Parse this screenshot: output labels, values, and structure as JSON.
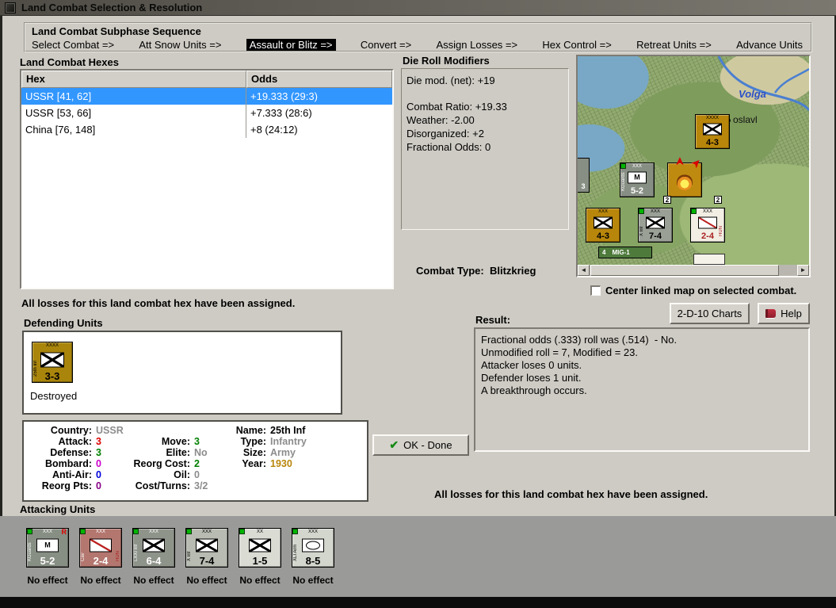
{
  "window": {
    "title": "Land Combat Selection & Resolution"
  },
  "icons": {
    "ok_check": "✔",
    "scroll_left": "◄",
    "scroll_right": "►",
    "attack_arrow": "➤",
    "militia_m": "M"
  },
  "sequence": {
    "title": "Land Combat Subphase Sequence",
    "steps": [
      {
        "label": "Select Combat =>"
      },
      {
        "label": "Att Snow Units =>"
      },
      {
        "label": "Assault or Blitz =>"
      },
      {
        "label": "Convert =>"
      },
      {
        "label": "Assign Losses =>"
      },
      {
        "label": "Hex Control =>"
      },
      {
        "label": "Retreat Units =>"
      },
      {
        "label": "Advance Units"
      }
    ],
    "active_index": 2
  },
  "hex_list": {
    "title": "Land Combat Hexes",
    "columns": {
      "hex": "Hex",
      "odds": "Odds"
    },
    "rows": [
      {
        "hex": "USSR [41, 62]",
        "odds": "+19.333 (29:3)"
      },
      {
        "hex": "USSR [53, 66]",
        "odds": "+7.333 (28:6)"
      },
      {
        "hex": "China [76, 148]",
        "odds": "+8 (24:12)"
      }
    ],
    "selected_index": 0,
    "selection_color": "#3296ff"
  },
  "modifiers": {
    "title": "Die Roll Modifiers",
    "net_line": "Die mod. (net): +19",
    "lines": [
      "Combat Ratio: +19.33",
      "Weather: -2.00",
      "Disorganized: +2",
      "Fractional Odds: 0"
    ]
  },
  "combat_type": {
    "label": "Combat Type:",
    "value": "Blitzkrieg"
  },
  "map": {
    "river_label": "Volga",
    "city_label": "oslavl",
    "edge_stack_count": "3",
    "stack_counts": [
      "2",
      "2"
    ],
    "units": [
      {
        "size": "XXXX",
        "name": "",
        "strength": "4-3",
        "color": "#b8860b"
      },
      {
        "size": "XXX",
        "name": "KGuards",
        "strength": "5-2",
        "color": "#878e83"
      },
      {
        "size": "XXX",
        "name": "X Inf",
        "strength": "7-4",
        "color": "#9aa096"
      },
      {
        "size": "XXX",
        "name": "HUN",
        "strength": "2-4",
        "color": "#f2eee4"
      },
      {
        "size": "XXX",
        "name": "",
        "strength": "4-3",
        "color": "#b8860b"
      }
    ],
    "air_unit": {
      "count": "4",
      "name": "MIG-1",
      "color": "#4e7a3c"
    },
    "checkbox_label": "Center linked map on selected combat.",
    "checkbox_checked": false
  },
  "buttons": {
    "charts": "2-D-10 Charts",
    "help": "Help",
    "ok": "OK - Done"
  },
  "messages": {
    "left": "All losses for this land combat hex have been assigned.",
    "right": "All losses for this land combat hex have been assigned."
  },
  "defending": {
    "title": "Defending Units",
    "unit": {
      "size": "XXXX",
      "name": "25th Inf",
      "strength": "3-3",
      "color": "#a9850c",
      "status": "Destroyed"
    }
  },
  "details": {
    "c1": [
      {
        "label": "Country:",
        "value": "USSR",
        "color": "#8c8c8c"
      },
      {
        "label": "Attack:",
        "value": "3",
        "color": "#dd0000"
      },
      {
        "label": "Defense:",
        "value": "3",
        "color": "#008000"
      },
      {
        "label": "Bombard:",
        "value": "0",
        "color": "#cc00cc"
      },
      {
        "label": "Anti-Air:",
        "value": "0",
        "color": "#0000dd"
      },
      {
        "label": "Reorg Pts:",
        "value": "0",
        "color": "#880088"
      }
    ],
    "c2": [
      {
        "label": "",
        "value": "",
        "color": ""
      },
      {
        "label": "Move:",
        "value": "3",
        "color": "#008000"
      },
      {
        "label": "Elite:",
        "value": "No",
        "color": "#8c8c8c"
      },
      {
        "label": "Reorg Cost:",
        "value": "2",
        "color": "#008000"
      },
      {
        "label": "Oil:",
        "value": "0",
        "color": "#8c8c8c"
      },
      {
        "label": "Cost/Turns:",
        "value": "3/2",
        "color": "#8c8c8c"
      }
    ],
    "c3": [
      {
        "label": "Name:",
        "value": "25th Inf",
        "color": "#000000"
      },
      {
        "label": "Type:",
        "value": "Infantry",
        "color": "#8c8c8c"
      },
      {
        "label": "Size:",
        "value": "Army",
        "color": "#8c8c8c"
      },
      {
        "label": "Year:",
        "value": "1930",
        "color": "#b8860b"
      },
      {
        "label": "",
        "value": "",
        "color": ""
      },
      {
        "label": "",
        "value": "",
        "color": ""
      }
    ]
  },
  "result": {
    "title": "Result:",
    "lines": [
      "Fractional odds (.333) roll was (.514)  - No.",
      "Unmodified roll = 7, Modified = 23.",
      "Attacker loses 0 units.",
      "Defender loses 1 unit.",
      "A breakthrough occurs."
    ]
  },
  "attacking": {
    "title": "Attacking Units",
    "units": [
      {
        "size": "XXX",
        "name": "KGuards",
        "strength": "5-2",
        "effect": "No effect",
        "color": "#878e83",
        "badge": "R"
      },
      {
        "size": "XXX",
        "name": "Cav",
        "tag": "HUN",
        "strength": "2-4",
        "effect": "No effect",
        "color": "#b3776f"
      },
      {
        "size": "XXX",
        "name": "LXXI Inf",
        "strength": "6-4",
        "effect": "No effect",
        "color": "#8f948b"
      },
      {
        "size": "XXX",
        "name": "X Inf",
        "strength": "7-4",
        "effect": "No effect",
        "color": "#b7bbb1"
      },
      {
        "size": "XX",
        "name": "",
        "strength": "1-5",
        "effect": "No effect",
        "color": "#dadcd4"
      },
      {
        "size": "XXX",
        "name": "XLI Arm",
        "strength": "8-5",
        "effect": "No effect",
        "color": "#d3d6cd"
      }
    ]
  }
}
